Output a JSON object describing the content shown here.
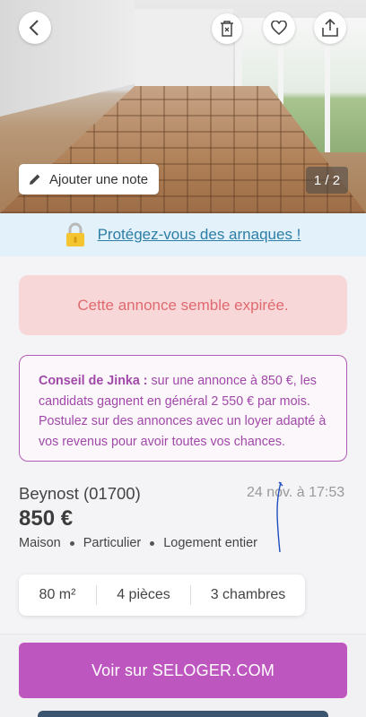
{
  "photo": {
    "note_button_label": "Ajouter une note",
    "counter": "1 / 2"
  },
  "icons": {
    "back": "chevron-left-icon",
    "remove": "trash-icon",
    "favorite": "heart-icon",
    "share": "share-icon",
    "note": "pencil-icon",
    "lock": "lock-icon"
  },
  "scam_banner": {
    "link_text": "Protégez-vous des arnaques !"
  },
  "expired_notice": {
    "text": "Cette annonce semble expirée."
  },
  "advice": {
    "label": "Conseil de Jinka :",
    "text": " sur une annonce à 850 €, les candidats gagnent en général 2 550 € par mois. Postulez sur des annonces avec un loyer adapté à vos revenus pour avoir toutes vos chances."
  },
  "listing": {
    "location": "Beynost (01700)",
    "date": "24 nov. à 17:53",
    "price": "850 €",
    "tags": [
      "Maison",
      "Particulier",
      "Logement entier"
    ],
    "features": [
      "80 m²",
      "4 pièces",
      "3 chambres"
    ]
  },
  "cta": {
    "label": "Voir sur SELOGER.COM"
  },
  "colors": {
    "accent": "#bd56be",
    "advice_border": "#b35bb6",
    "expired_bg": "#f7d7d8",
    "expired_text": "#e06a6f",
    "banner_bg": "#e3f1fb",
    "link": "#2d7ea6"
  }
}
